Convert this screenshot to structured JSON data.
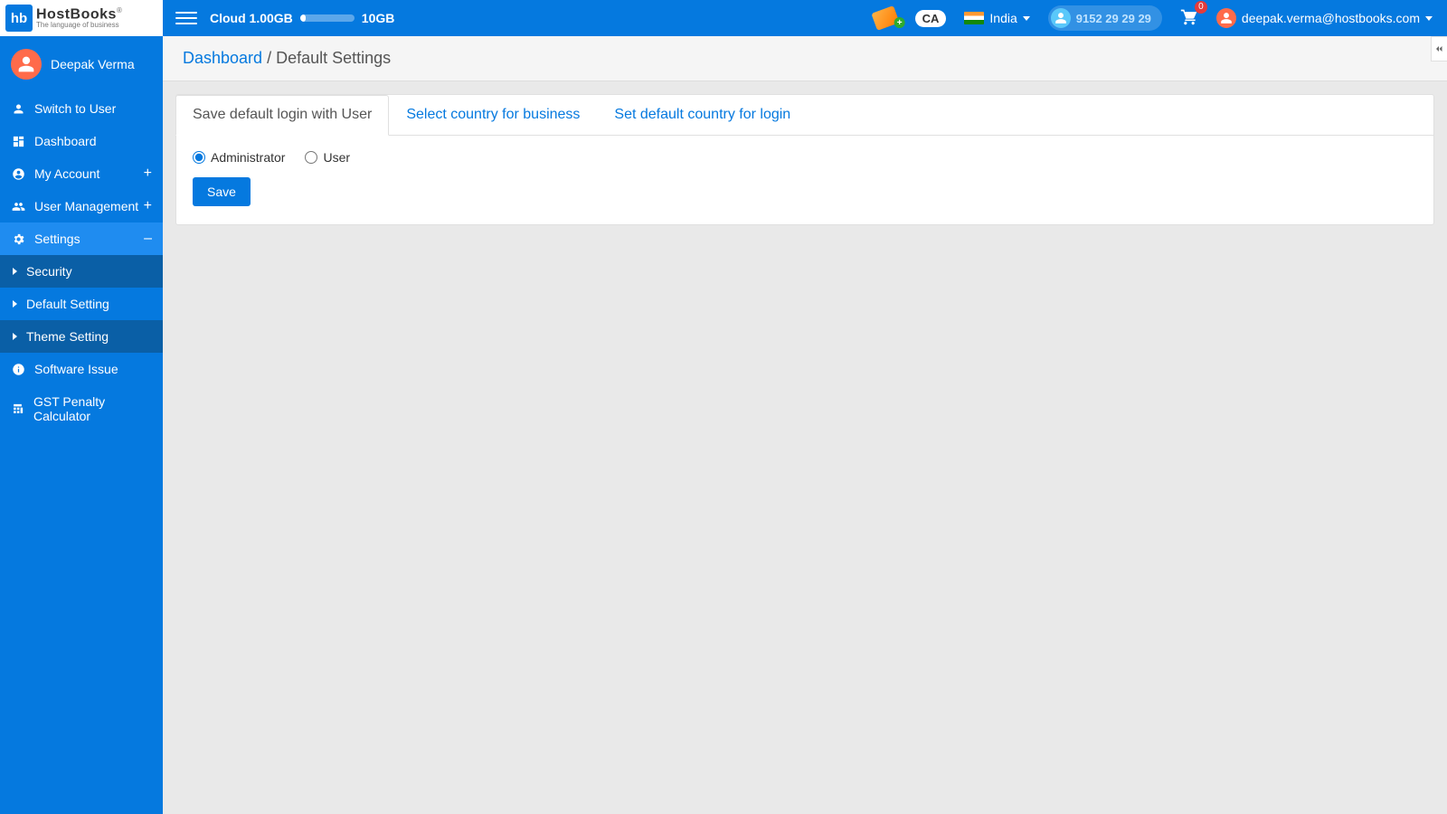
{
  "brand": {
    "hb": "hb",
    "name": "HostBooks",
    "reg": "®",
    "tagline": "The language of business"
  },
  "topbar": {
    "cloud_label": "Cloud 1.00GB",
    "cloud_max": "10GB",
    "ca_badge": "CA",
    "country": "India",
    "support_number": "9152 29 29 29",
    "cart_count": "0",
    "email": "deepak.verma@hostbooks.com"
  },
  "sidebar": {
    "user_name": "Deepak Verma",
    "items": {
      "switch": "Switch to User",
      "dashboard": "Dashboard",
      "account": "My Account",
      "usermgmt": "User Management",
      "settings": "Settings",
      "security": "Security",
      "default_setting": "Default Setting",
      "theme": "Theme Setting",
      "software_issue": "Software Issue",
      "gst": "GST Penalty Calculator"
    }
  },
  "breadcrumb": {
    "root": "Dashboard",
    "sep": " / ",
    "current": "Default Settings"
  },
  "tabs": {
    "t1": "Save default login with User",
    "t2": "Select country for business",
    "t3": "Set default country for login"
  },
  "form": {
    "opt_admin": "Administrator",
    "opt_user": "User",
    "save": "Save"
  }
}
